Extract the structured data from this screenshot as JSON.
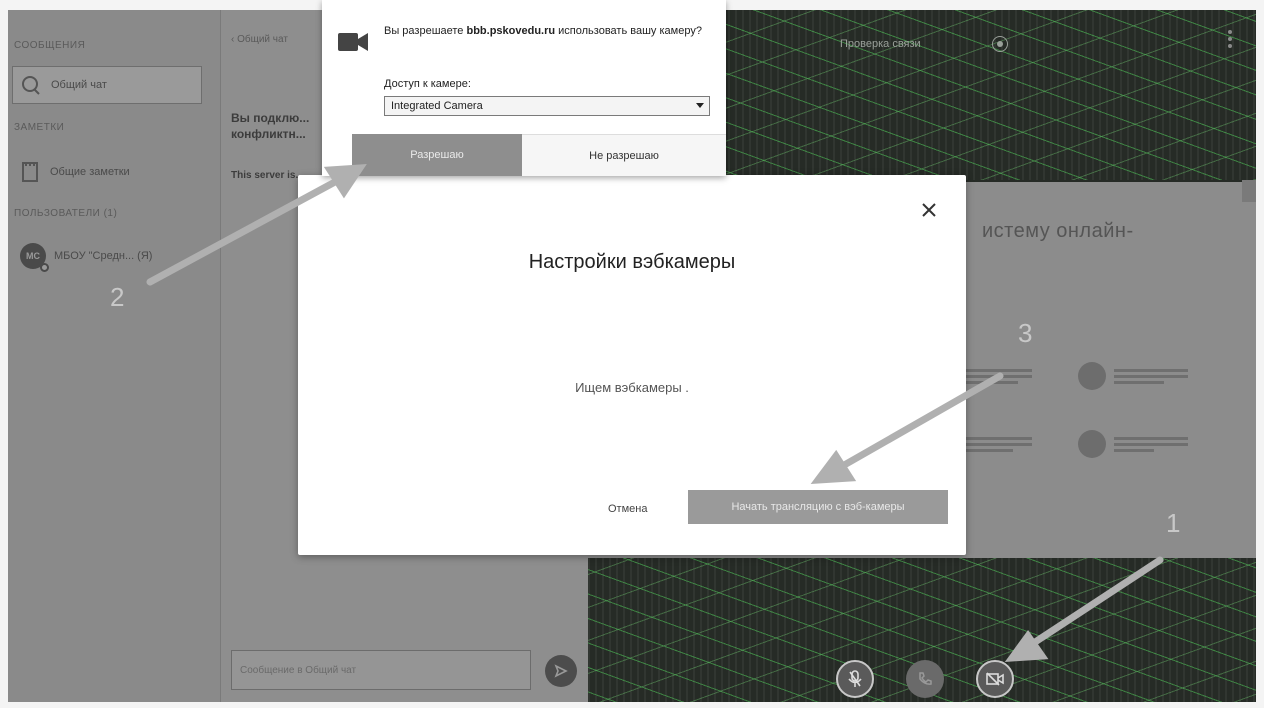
{
  "left_panel": {
    "messages_title": "СООБЩЕНИЯ",
    "public_chat": "Общий чат",
    "notes_title": "ЗАМЕТКИ",
    "shared_notes": "Общие заметки",
    "users_title": "ПОЛЬЗОВАТЕЛИ (1)",
    "user": {
      "initials": "МС",
      "name": "МБОУ \"Средн... (Я)"
    }
  },
  "chat": {
    "back_label": "‹ Общий чат",
    "welcome": "Вы подклю... конфликтн...",
    "server_note": "This server is...",
    "input_placeholder": "Сообщение в Общий чат",
    "send_icon": "send-icon"
  },
  "main": {
    "connection_label": "Проверка связи",
    "presentation_title": "истему онлайн-",
    "controls": {
      "mic_icon": "mic-icon",
      "phone_icon": "phone-icon",
      "camera_icon": "camera-icon"
    }
  },
  "modal": {
    "title": "Настройки вэбкамеры",
    "status": "Ищем вэбкамеры .",
    "cancel_label": "Отмена",
    "start_label": "Начать трансляцию с вэб-камеры",
    "close_icon": "close-icon"
  },
  "permission_popup": {
    "question_prefix": "Вы разрешаете ",
    "domain": "bbb.pskovedu.ru",
    "question_suffix": " использовать вашу камеру?",
    "access_label": "Доступ к камере:",
    "camera_selected": "Integrated Camera",
    "allow_label": "Разрешаю",
    "deny_label": "Не разрешаю",
    "camera_icon": "camera-icon"
  },
  "annotations": [
    "1",
    "2",
    "3"
  ],
  "colors": {
    "overlay_gray": "#7f7f7f",
    "video_dark": "#262b26",
    "noise_green": "#50c85a"
  }
}
